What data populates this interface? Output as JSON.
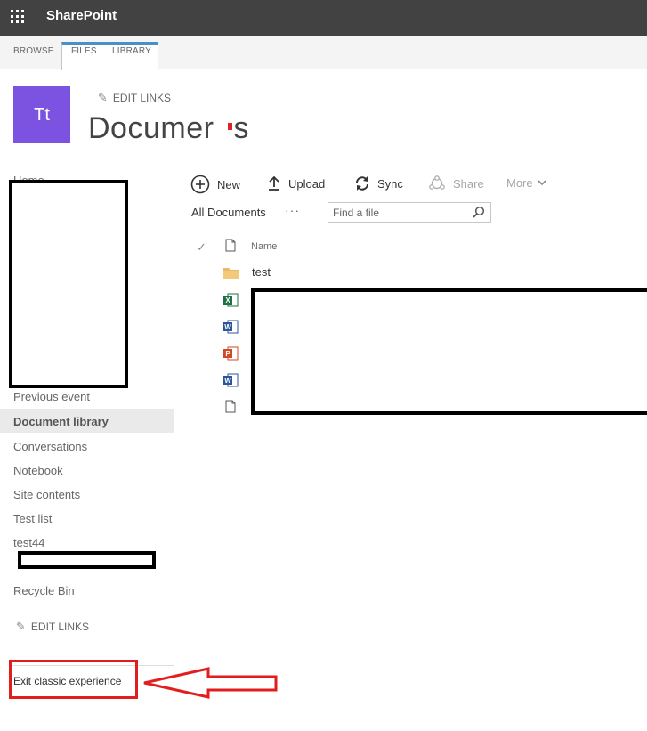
{
  "suite": {
    "brand": "SharePoint",
    "icon": "waffle-icon"
  },
  "ribbon": {
    "tabs": [
      "BROWSE",
      "FILES",
      "LIBRARY"
    ]
  },
  "site": {
    "logo_initials": "Tt",
    "logo_color": "#7b53e0",
    "edit_links": "EDIT LINKS",
    "title": "Documer",
    "title_tail": "s"
  },
  "nav": {
    "items": [
      "Home",
      "Previous event",
      "Document library",
      "Conversations",
      "Notebook",
      "Site contents",
      "Test list",
      "test44",
      "Recycle Bin"
    ],
    "selected": "Document library",
    "edit_links": "EDIT LINKS",
    "exit_link": "Exit classic experience"
  },
  "commands": {
    "new": "New",
    "upload": "Upload",
    "sync": "Sync",
    "share": "Share",
    "more": "More"
  },
  "view": {
    "name": "All Documents",
    "dots": "···",
    "search_placeholder": "Find a file"
  },
  "list": {
    "header_name": "Name",
    "items": [
      {
        "name": "test",
        "type": "folder"
      },
      {
        "name": "",
        "type": "excel"
      },
      {
        "name": "",
        "type": "word"
      },
      {
        "name": "",
        "type": "powerpoint"
      },
      {
        "name": "",
        "type": "word"
      },
      {
        "name": "",
        "type": "generic"
      }
    ]
  },
  "colors": {
    "suitebar": "#424242",
    "accent": "#4a90c8",
    "annotation": "#e11d1d"
  }
}
